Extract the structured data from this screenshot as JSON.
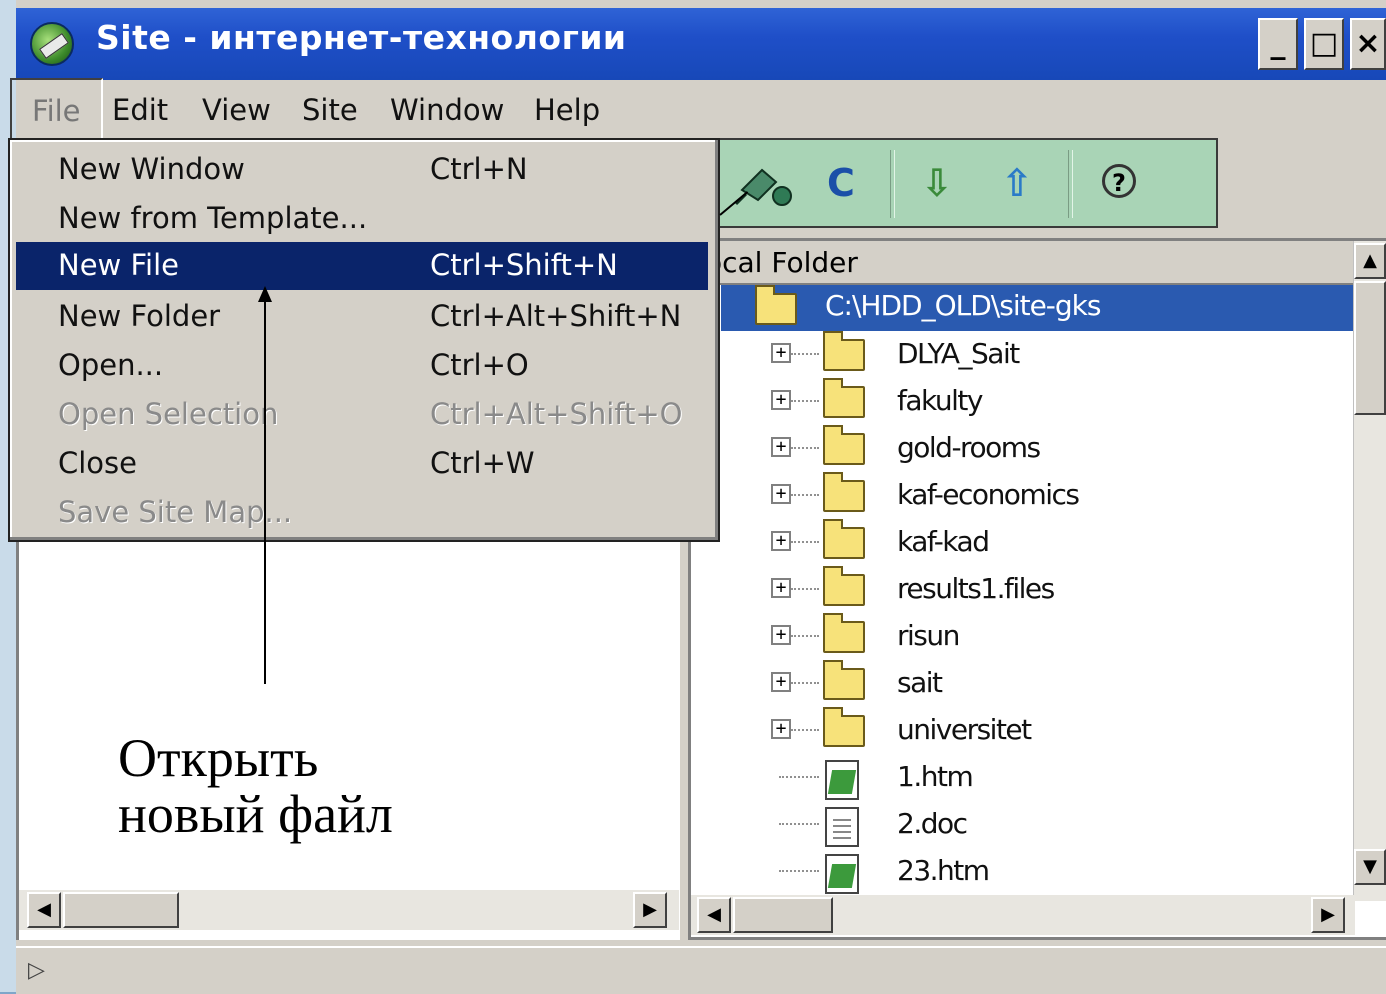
{
  "window": {
    "title": "Site - интернет-технологии",
    "controls": [
      "_",
      "□",
      "×"
    ]
  },
  "menubar": {
    "items": [
      "File",
      "Edit",
      "View",
      "Site",
      "Window",
      "Help"
    ]
  },
  "file_menu": {
    "items": [
      {
        "label": "New Window",
        "shortcut": "Ctrl+N",
        "state": "normal"
      },
      {
        "label": "New from Template...",
        "shortcut": "",
        "state": "normal"
      },
      {
        "label": "New File",
        "shortcut": "Ctrl+Shift+N",
        "state": "selected"
      },
      {
        "label": "New Folder",
        "shortcut": "Ctrl+Alt+Shift+N",
        "state": "normal"
      },
      {
        "label": "Open...",
        "shortcut": "Ctrl+O",
        "state": "normal"
      },
      {
        "label": "Open Selection",
        "shortcut": "Ctrl+Alt+Shift+O",
        "state": "disabled"
      },
      {
        "label": "Close",
        "shortcut": "Ctrl+W",
        "state": "normal"
      },
      {
        "label": "Save Site Map...",
        "shortcut": "",
        "state": "disabled"
      }
    ]
  },
  "toolbar": {
    "icons": [
      "connect-icon",
      "refresh-icon",
      "get-down-icon",
      "put-up-icon",
      "help-icon"
    ],
    "refresh_glyph": "C",
    "down_glyph": "⇩",
    "up_glyph": "⇧",
    "help_glyph": "?"
  },
  "local_pane": {
    "header": "ocal Folder",
    "root_path": "C:\\HDD_OLD\\site-gks",
    "items": [
      {
        "name": "DLYA_Sait",
        "type": "folder"
      },
      {
        "name": "fakulty",
        "type": "folder"
      },
      {
        "name": "gold-rooms",
        "type": "folder"
      },
      {
        "name": "kaf-economics",
        "type": "folder"
      },
      {
        "name": "kaf-kad",
        "type": "folder"
      },
      {
        "name": "results1.files",
        "type": "folder"
      },
      {
        "name": "risun",
        "type": "folder"
      },
      {
        "name": "sait",
        "type": "folder"
      },
      {
        "name": "universitet",
        "type": "folder"
      },
      {
        "name": "1.htm",
        "type": "htm"
      },
      {
        "name": "2.doc",
        "type": "doc"
      },
      {
        "name": "23.htm",
        "type": "htm"
      }
    ]
  },
  "scroll": {
    "left": "◀",
    "right": "▶",
    "up": "▲",
    "down": "▼"
  },
  "status": {
    "arrow": "▷"
  },
  "annotation": {
    "line1": "Открыть",
    "line2": "новый файл"
  }
}
